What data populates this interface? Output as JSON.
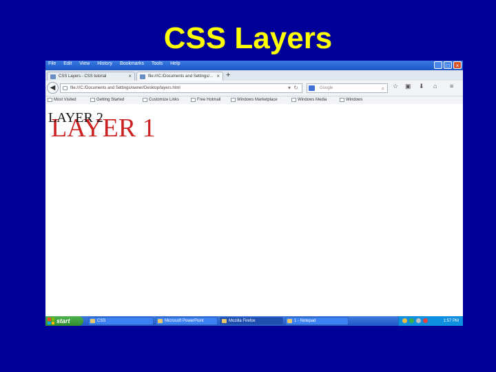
{
  "slide": {
    "title": "CSS Layers"
  },
  "browser": {
    "menu": [
      "File",
      "Edit",
      "View",
      "History",
      "Bookmarks",
      "Tools",
      "Help"
    ],
    "tabs": [
      {
        "label": "CSS Layers - CSS tutorial",
        "close": "×"
      },
      {
        "label": "file:///C:/Documents and Settings/...",
        "close": "×"
      }
    ],
    "new_tab": "+",
    "window_buttons": {
      "minimize": "_",
      "maximize": "□",
      "close": "×"
    },
    "nav": {
      "back": "◀",
      "url": "file:///C:/Documents and Settings/owner/Desktop/layers.html",
      "search_placeholder": "Google"
    },
    "bookmarks": [
      "Most Visited",
      "Getting Started",
      "Customize Links",
      "Free Hotmail",
      "Windows Marketplace",
      "Windows Media",
      "Windows"
    ]
  },
  "page": {
    "layer1_text": "LAYER 1",
    "layer2_text": "LAYER 2"
  },
  "taskbar": {
    "start_label": "start",
    "tasks": [
      "CSS",
      "Microsoft PowerPoint",
      "Mozilla Firefox",
      "1 - Notepad"
    ],
    "clock": "1:57 PM"
  },
  "colors": {
    "slide_background": "#000099",
    "title_color": "#ffff00",
    "layer1_color": "#cc2222",
    "layer2_color": "#111111"
  }
}
